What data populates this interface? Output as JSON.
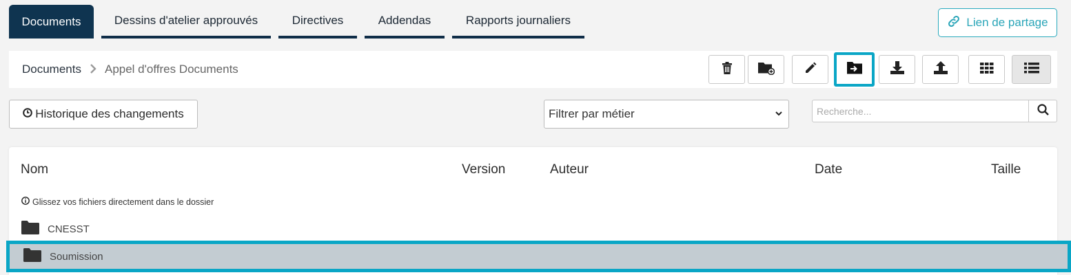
{
  "tabs": [
    {
      "label": "Documents",
      "active": true
    },
    {
      "label": "Dessins d'atelier approuvés"
    },
    {
      "label": "Directives"
    },
    {
      "label": "Addendas"
    },
    {
      "label": "Rapports journaliers"
    }
  ],
  "share_button": {
    "label": "Lien de partage",
    "icon": "link-icon"
  },
  "breadcrumb": {
    "root": "Documents",
    "current": "Appel d'offres Documents"
  },
  "toolbar": {
    "buttons": [
      {
        "name": "delete",
        "icon": "trash-icon"
      },
      {
        "name": "new-folder",
        "icon": "folder-plus-icon"
      },
      {
        "name": "rename",
        "icon": "pencil-icon"
      },
      {
        "name": "move",
        "icon": "folder-move-icon",
        "highlighted": true
      },
      {
        "name": "download",
        "icon": "download-icon"
      },
      {
        "name": "upload",
        "icon": "upload-icon"
      },
      {
        "name": "grid-view",
        "icon": "grid-icon"
      },
      {
        "name": "list-view",
        "icon": "list-icon",
        "pressed": true
      }
    ]
  },
  "history_button": {
    "label": "Historique des changements",
    "icon": "clock-icon"
  },
  "filter": {
    "selected": "Filtrer par métier"
  },
  "search": {
    "placeholder": "Recherche..."
  },
  "table": {
    "columns": {
      "name": "Nom",
      "version": "Version",
      "author": "Auteur",
      "date": "Date",
      "size": "Taille"
    },
    "hint": "Glissez vos fichiers directement dans le dossier",
    "rows": [
      {
        "name": "CNESST",
        "type": "folder"
      },
      {
        "name": "Soumission",
        "type": "folder",
        "selected": true
      }
    ]
  },
  "colors": {
    "primary": "#0f3450",
    "accent": "#29a9bd",
    "highlight": "#0aa6c6",
    "selected_row": "#c3ccd2"
  }
}
